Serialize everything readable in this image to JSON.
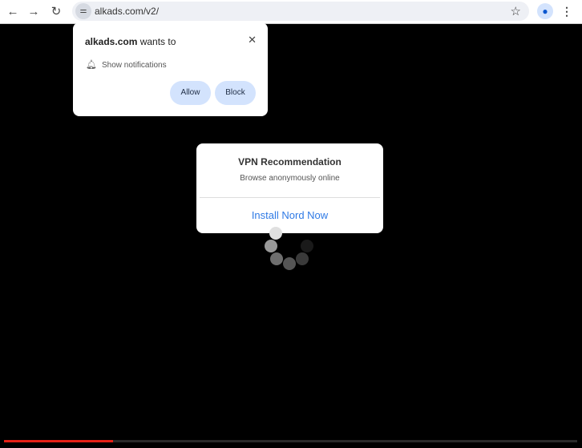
{
  "browser": {
    "url": "alkads.com/v2/",
    "back_icon": "arrow-left",
    "forward_icon": "arrow-right",
    "reload_icon": "reload"
  },
  "permission_prompt": {
    "site": "alkads.com",
    "wants_to": " wants to",
    "permission": "Show notifications",
    "allow_label": "Allow",
    "block_label": "Block",
    "close_glyph": "✕"
  },
  "vpn_popup": {
    "title": "VPN Recommendation",
    "subtitle": "Browse anonymously online",
    "cta": "Install Nord Now",
    "cta_color": "#2f7ae5"
  },
  "video": {
    "progress_percent": 19,
    "progress_color": "#e62117"
  }
}
